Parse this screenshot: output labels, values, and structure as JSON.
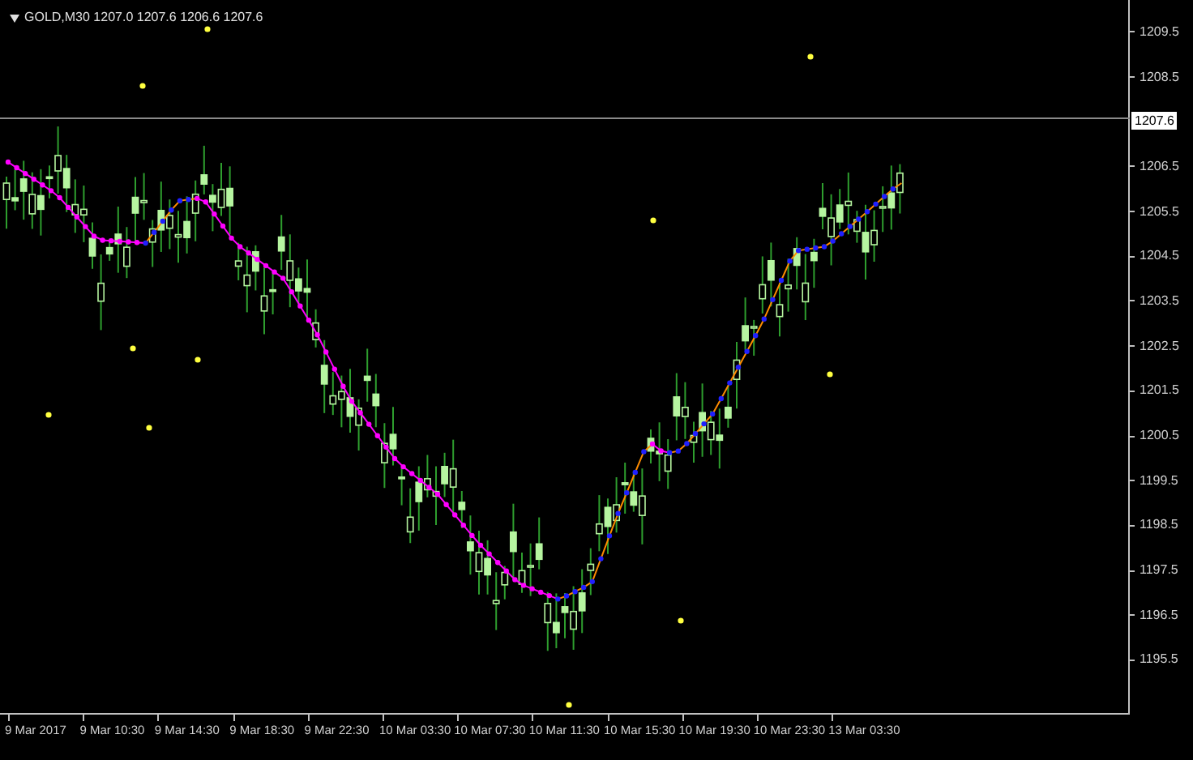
{
  "header": {
    "symbol": "GOLD,M30",
    "ohlc": [
      "1207.0",
      "1207.6",
      "1206.6",
      "1207.6"
    ]
  },
  "price_axis": {
    "labels": [
      {
        "kind": "tick",
        "text": "1209.5"
      },
      {
        "kind": "tick",
        "text": "1208.5"
      },
      {
        "kind": "current",
        "text": "1207.6"
      },
      {
        "kind": "tick",
        "text": "1206.5"
      },
      {
        "kind": "tick",
        "text": "1205.5"
      },
      {
        "kind": "tick",
        "text": "1204.5"
      },
      {
        "kind": "tick",
        "text": "1203.5"
      },
      {
        "kind": "tick",
        "text": "1202.5"
      },
      {
        "kind": "tick",
        "text": "1201.5"
      },
      {
        "kind": "tick",
        "text": "1200.5"
      },
      {
        "kind": "tick",
        "text": "1199.5"
      },
      {
        "kind": "tick",
        "text": "1198.5"
      },
      {
        "kind": "tick",
        "text": "1197.5"
      },
      {
        "kind": "tick",
        "text": "1196.5"
      },
      {
        "kind": "tick",
        "text": "1195.5"
      }
    ]
  },
  "time_axis": {
    "labels": [
      "9 Mar 2017",
      "9 Mar 10:30",
      "9 Mar 14:30",
      "9 Mar 18:30",
      "9 Mar 22:30",
      "10 Mar 03:30",
      "10 Mar 07:30",
      "10 Mar 11:30",
      "10 Mar 15:30",
      "10 Mar 19:30",
      "10 Mar 23:30",
      "13 Mar 03:30"
    ]
  }
}
